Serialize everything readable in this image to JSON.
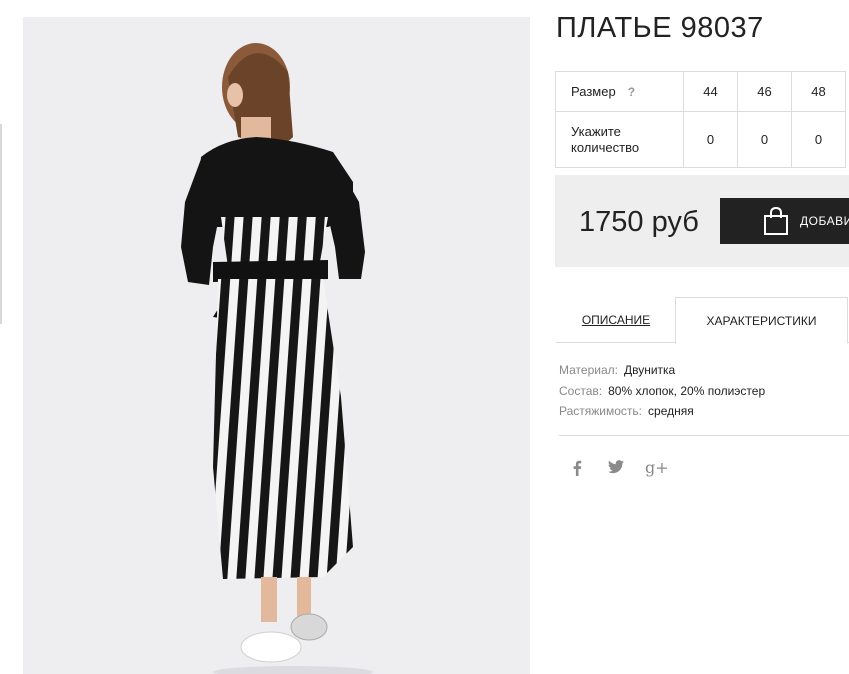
{
  "product": {
    "title": "ПЛАТЬЕ 98037"
  },
  "size_table": {
    "size_label": "Размер",
    "help_icon": "?",
    "sizes": [
      "44",
      "46",
      "48"
    ],
    "qty_label": "Укажите количество",
    "quantities": [
      "0",
      "0",
      "0"
    ]
  },
  "purchase": {
    "price": "1750 руб",
    "add_button_label": "ДОБАВИ",
    "button_icon": "shopping-bag-icon"
  },
  "tabs": [
    {
      "label": "ОПИСАНИЕ",
      "active": false
    },
    {
      "label": "ХАРАКТЕРИСТИКИ",
      "active": true
    }
  ],
  "characteristics": [
    {
      "key": "Материал:",
      "value": "Двунитка"
    },
    {
      "key": "Состав:",
      "value": "80% хлопок, 20% полиэстер"
    },
    {
      "key": "Растяжимость:",
      "value": "средняя"
    }
  ],
  "social": [
    {
      "icon": "facebook-icon",
      "glyph": "f"
    },
    {
      "icon": "twitter-icon",
      "glyph": "t"
    },
    {
      "icon": "google-plus-icon",
      "glyph": "g+"
    }
  ],
  "colors": {
    "button_bg": "#222222",
    "price_box_bg": "#eeeeee",
    "photo_bg": "#eeeef1"
  }
}
